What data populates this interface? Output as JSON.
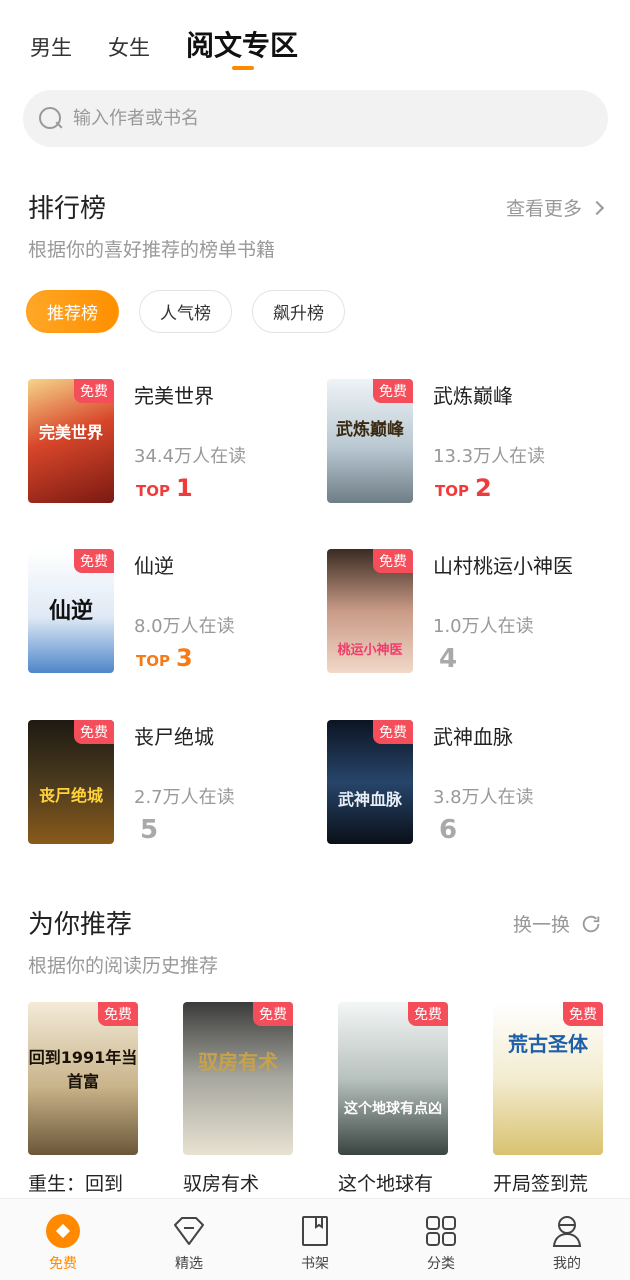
{
  "top_tabs": [
    "男生",
    "女生",
    "阅文专区"
  ],
  "search": {
    "placeholder": "输入作者或书名"
  },
  "ranking": {
    "title": "排行榜",
    "subtitle": "根据你的喜好推荐的榜单书籍",
    "more_label": "查看更多",
    "filters": [
      "推荐榜",
      "人气榜",
      "飙升榜"
    ],
    "active_filter": "推荐榜",
    "free_tag": "免费",
    "top_label": "TOP",
    "items": [
      {
        "title": "完美世界",
        "readers": "34.4万人在读",
        "rank": "1"
      },
      {
        "title": "武炼巅峰",
        "readers": "13.3万人在读",
        "rank": "2"
      },
      {
        "title": "仙逆",
        "readers": "8.0万人在读",
        "rank": "3"
      },
      {
        "title": "山村桃运小神医",
        "readers": "1.0万人在读",
        "rank": "4"
      },
      {
        "title": "丧尸绝城",
        "readers": "2.7万人在读",
        "rank": "5"
      },
      {
        "title": "武神血脉",
        "readers": "3.8万人在读",
        "rank": "6"
      }
    ],
    "cover_art": [
      "完美世界",
      "武炼巅峰",
      "仙逆",
      "桃运小神医",
      "丧尸绝城",
      "武神血脉"
    ]
  },
  "recommend": {
    "title": "为你推荐",
    "subtitle": "根据你的阅读历史推荐",
    "refresh_label": "换一换",
    "items": [
      {
        "title": "重生：回到"
      },
      {
        "title": "驭房有术"
      },
      {
        "title": "这个地球有"
      },
      {
        "title": "开局签到荒"
      }
    ],
    "cover_art": [
      "回到1991年当首富",
      "驭房有术",
      "这个地球有点凶",
      "荒古圣体"
    ]
  },
  "bottom_nav": [
    "免费",
    "精选",
    "书架",
    "分类",
    "我的"
  ],
  "colors": {
    "accent": "#ff8a00",
    "free_tag": "#f44e5a",
    "top_red": "#ef3b3b",
    "top_orange": "#f77a16"
  }
}
